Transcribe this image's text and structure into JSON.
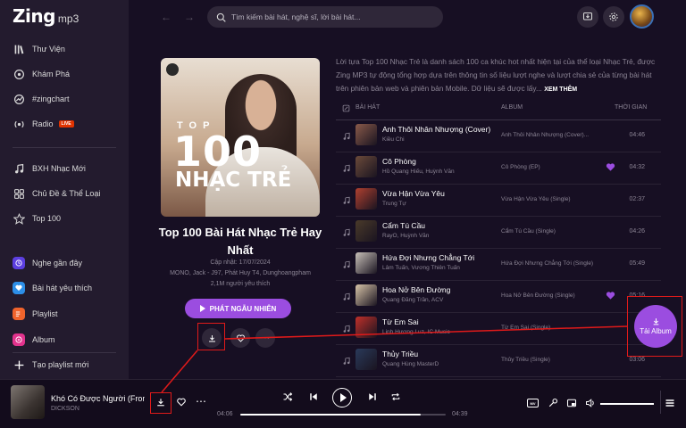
{
  "brand": {
    "name": "Zing",
    "suffix": "mp3"
  },
  "sidebar": {
    "main": [
      {
        "label": "Thư Viện",
        "icon": "library-icon"
      },
      {
        "label": "Khám Phá",
        "icon": "discover-icon"
      },
      {
        "label": "#zingchart",
        "icon": "chart-icon"
      },
      {
        "label": "Radio",
        "icon": "radio-icon",
        "badge": "LIVE"
      }
    ],
    "browse": [
      {
        "label": "BXH Nhạc Mới",
        "icon": "music-note-icon"
      },
      {
        "label": "Chủ Đề & Thể Loại",
        "icon": "category-icon"
      },
      {
        "label": "Top 100",
        "icon": "star-icon"
      }
    ],
    "library": [
      {
        "label": "Nghe gần đây",
        "icon": "history-icon",
        "color": "#5c3fe0"
      },
      {
        "label": "Bài hát yêu thích",
        "icon": "favorite-songs-icon",
        "color": "#2d8fe8"
      },
      {
        "label": "Playlist",
        "icon": "playlist-icon",
        "color": "#f0632c"
      },
      {
        "label": "Album",
        "icon": "album-icon",
        "color": "#e2338d"
      }
    ],
    "create_playlist": "Tạo playlist mới"
  },
  "header": {
    "search_placeholder": "Tìm kiếm bài hát, nghệ sĩ, lời bài hát..."
  },
  "album": {
    "cover_top": "TOP",
    "cover_100": "100",
    "cover_genre": "NHẠC TRẺ",
    "title": "Top 100 Bài Hát Nhạc Trẻ Hay Nhất",
    "updated": "Cập nhật: 17/07/2024",
    "artists": "MONO, Jack - J97, Phát Huy T4, Dunghoangpham",
    "likes": "2,1M người yêu thích",
    "play_all": "PHÁT NGẪU NHIÊN"
  },
  "description": {
    "text": "Lời tựa Top 100 Nhạc Trẻ là danh sách 100 ca khúc hot nhất hiện tại của thể loại Nhạc Trẻ, được Zing MP3 tự động tổng hợp dựa trên thông tin số liệu lượt nghe và lượt chia sẻ của từng bài hát trên phiên bản web và phiên bản Mobile. Dữ liệu sẽ được lấy...",
    "more": "XEM THÊM"
  },
  "table": {
    "col_song": "BÀI HÁT",
    "col_album": "ALBUM",
    "col_time": "THỜI GIAN",
    "rows": [
      {
        "name": "Anh Thôi Nhân Nhượng (Cover)",
        "artist": "Kiều Chi",
        "album": "Anh Thôi Nhân Nhượng (Cover)...",
        "duration": "04:46",
        "liked": false,
        "color": "#8a5a4a"
      },
      {
        "name": "Cô Phòng",
        "artist": "Hồ Quang Hiếu, Huỳnh Văn",
        "album": "Cô Phòng (EP)",
        "duration": "04:32",
        "liked": true,
        "color": "#6b4a3a"
      },
      {
        "name": "Vừa Hận Vừa Yêu",
        "artist": "Trung Tự",
        "album": "Vừa Hận Vừa Yêu (Single)",
        "duration": "02:37",
        "liked": false,
        "color": "#b04030"
      },
      {
        "name": "Cẩm Tú Cầu",
        "artist": "RayO, Huỳnh Văn",
        "album": "Cẩm Tú Cầu (Single)",
        "duration": "04:26",
        "liked": false,
        "color": "#4a3a2a"
      },
      {
        "name": "Hứa Đợi Nhưng Chẳng Tới",
        "artist": "Lâm Tuấn, Vương Thiên Tuấn",
        "album": "Hứa Đợi Nhưng Chẳng Tới (Single)",
        "duration": "05:49",
        "liked": false,
        "color": "#c8c0b8"
      },
      {
        "name": "Hoa Nở Bên Đường",
        "artist": "Quang Đăng Trần, ACV",
        "album": "Hoa Nở Bên Đường (Single)",
        "duration": "05:16",
        "liked": true,
        "color": "#d8c4a8"
      },
      {
        "name": "Từ Em Sai",
        "artist": "Linh Hương Luz, IC Music",
        "album": "Từ Em Sai (Single)",
        "duration": "",
        "liked": false,
        "color": "#c0302a"
      },
      {
        "name": "Thủy Triều",
        "artist": "Quang Hùng MasterD",
        "album": "Thủy Triều (Single)",
        "duration": "03:06",
        "liked": false,
        "color": "#2a3a5a"
      }
    ]
  },
  "download_album": {
    "label": "Tải Album"
  },
  "player": {
    "title": "Khó Có Được Người (From",
    "artist": "DICKSON",
    "current_time": "04:06",
    "total_time": "04:39",
    "progress": 0.88,
    "mv_label": "MV"
  }
}
